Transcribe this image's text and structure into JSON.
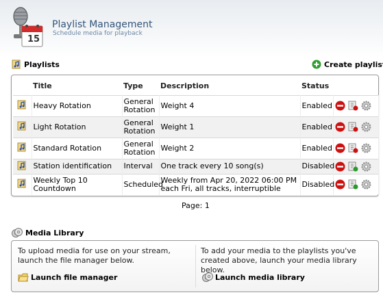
{
  "header": {
    "title": "Playlist Management",
    "subtitle": "Schedule media for playback",
    "calendar_day": "15"
  },
  "playlists": {
    "heading": "Playlists",
    "create_label": "Create playlist",
    "columns": [
      "Title",
      "Type",
      "Description",
      "Status"
    ],
    "rows": [
      {
        "title": "Heavy Rotation",
        "type": "General Rotation",
        "description": "Weight 4",
        "status": "Enabled"
      },
      {
        "title": "Light Rotation",
        "type": "General Rotation",
        "description": "Weight 1",
        "status": "Enabled"
      },
      {
        "title": "Standard Rotation",
        "type": "General Rotation",
        "description": "Weight 2",
        "status": "Enabled"
      },
      {
        "title": "Station identification",
        "type": "Interval",
        "description": "One track every 10 song(s)",
        "status": "Disabled"
      },
      {
        "title": "Weekly Top 10 Countdown",
        "type": "Scheduled",
        "description": "Weekly from Apr 20, 2022 06:00 PM each Fri, all tracks, interruptible",
        "status": "Disabled"
      }
    ],
    "page_label": "Page: 1"
  },
  "media_library": {
    "heading": "Media Library",
    "left_text": "To upload media for use on your stream, launch the file manager below.",
    "right_text": "To add your media to the playlists you've created above, launch your media library below.",
    "file_manager_label": "Launch file manager",
    "media_library_label": "Launch media library"
  },
  "colors": {
    "title_blue": "#33557a",
    "remove_red": "#cc1111",
    "enabled_badge": "#cc1111",
    "disabled_badge": "#2a9a2a",
    "add_green": "#2e9e2e"
  }
}
